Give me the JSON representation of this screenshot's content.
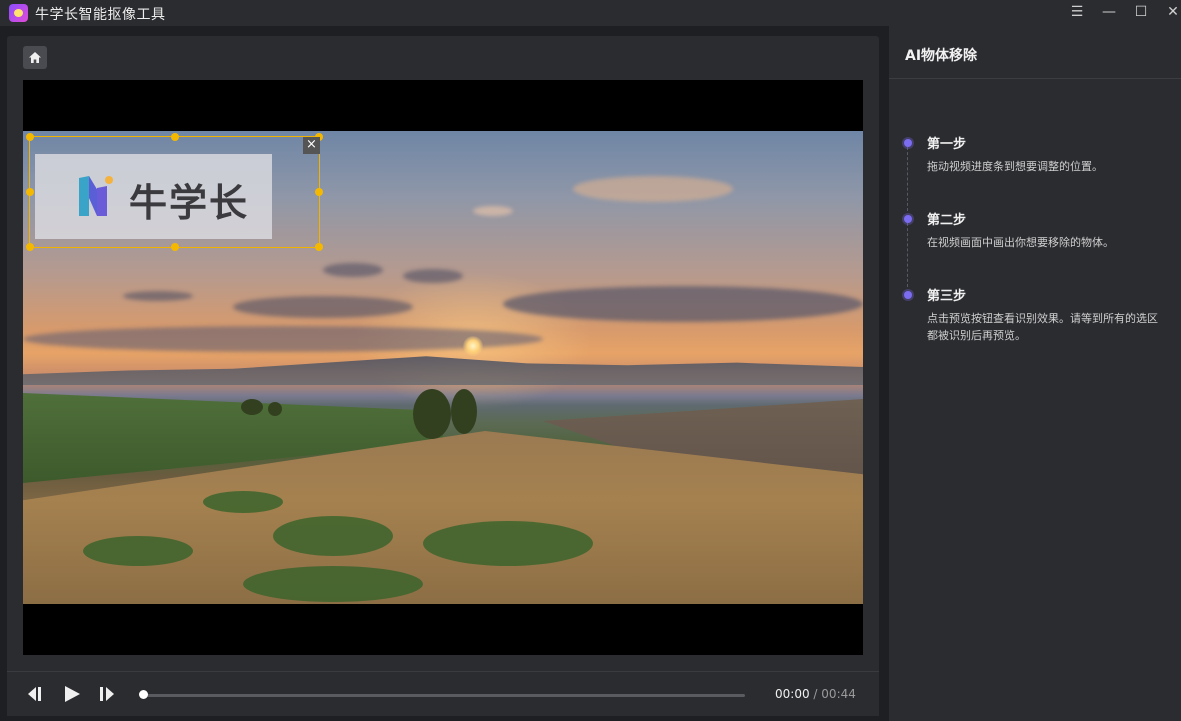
{
  "window": {
    "title": "牛学长智能抠像工具",
    "controls": {
      "menu": "☰",
      "minimize": "—",
      "maximize": "☐",
      "close": "✕"
    }
  },
  "preview": {
    "watermark_text": "牛学长",
    "selection_close": "×"
  },
  "player": {
    "current_time": "00:00",
    "separator": "/",
    "total_time": "00:44",
    "progress": 0
  },
  "panel": {
    "title": "AI物体移除",
    "steps": [
      {
        "title": "第一步",
        "desc": "拖动视频进度条到想要调整的位置。"
      },
      {
        "title": "第二步",
        "desc": "在视频画面中画出你想要移除的物体。"
      },
      {
        "title": "第三步",
        "desc": "点击预览按钮查看识别效果。请等到所有的选区都被识别后再预览。"
      }
    ]
  },
  "colors": {
    "accent": "#7b6cf0",
    "selection": "#f5b800",
    "background": "#1e1f22",
    "panel": "#2b2c30"
  },
  "icons": [
    "app-logo-icon",
    "menu-icon",
    "minimize-icon",
    "maximize-icon",
    "close-icon",
    "home-icon",
    "prev-frame-icon",
    "play-icon",
    "next-frame-icon"
  ]
}
